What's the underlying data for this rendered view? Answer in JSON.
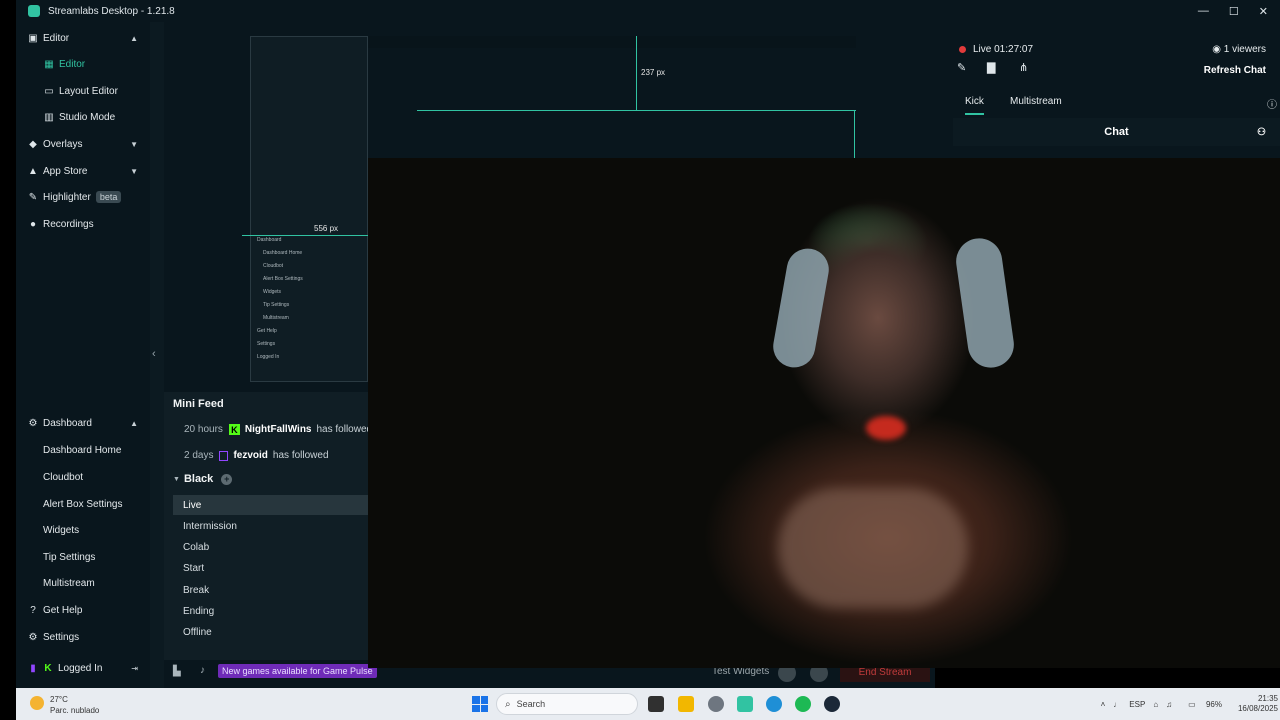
{
  "window": {
    "title": "Streamlabs Desktop - 1.21.8",
    "controls": [
      "—",
      "☐",
      "✕"
    ]
  },
  "sidebar": {
    "editor": "Editor",
    "editor_sub": "Editor",
    "layout_editor": "Layout Editor",
    "studio_mode": "Studio Mode",
    "overlays": "Overlays",
    "app_store": "App Store",
    "highlighter": "Highlighter",
    "beta": "beta",
    "recordings": "Recordings",
    "dashboard": "Dashboard",
    "dashboard_home": "Dashboard Home",
    "cloudbot": "Cloudbot",
    "alert_box": "Alert Box Settings",
    "widgets": "Widgets",
    "tip_settings": "Tip Settings",
    "multistream": "Multistream",
    "get_help": "Get Help",
    "settings": "Settings",
    "logged_in": "Logged In"
  },
  "preview": {
    "nested_lines": [
      "Dashboard",
      "Dashboard Home",
      "Cloudbot",
      "Alert Box Settings",
      "Widgets",
      "Tip Settings",
      "Multistream",
      "Get Help",
      "Settings",
      "Logged In"
    ],
    "size_label": "237 px",
    "size_label_2": "556 px"
  },
  "minifeed": {
    "title": "Mini Feed",
    "rows": [
      {
        "time": "20 hours",
        "user": "NightFallWins",
        "action": "has followed"
      },
      {
        "time": "2 days",
        "user": "fezvoid",
        "action": "has followed"
      }
    ]
  },
  "scenes": {
    "collection": "Black",
    "items": [
      "Live",
      "Intermission",
      "Colab",
      "Start",
      "Break",
      "Ending",
      "Offline"
    ],
    "active": "Live"
  },
  "footer": {
    "news": "New games available for Game Pulse",
    "test_widgets": "Test Widgets",
    "end_stream": "End Stream"
  },
  "chat": {
    "live_time": "Live 01:27:07",
    "viewers": "1 viewers",
    "refresh": "Refresh Chat",
    "tabs": [
      "Kick",
      "Multistream"
    ],
    "header": "Chat"
  },
  "taskbar": {
    "temp": "27°C",
    "weather": "Parc. nublado",
    "search": "Search",
    "lang": "ESP",
    "battery": "96%",
    "time": "21:35",
    "date": "16/08/2025"
  },
  "colors": {
    "accent": "#31c3a2",
    "panel": "#09161d",
    "live": "#e23b3b",
    "kick": "#53fc18"
  }
}
